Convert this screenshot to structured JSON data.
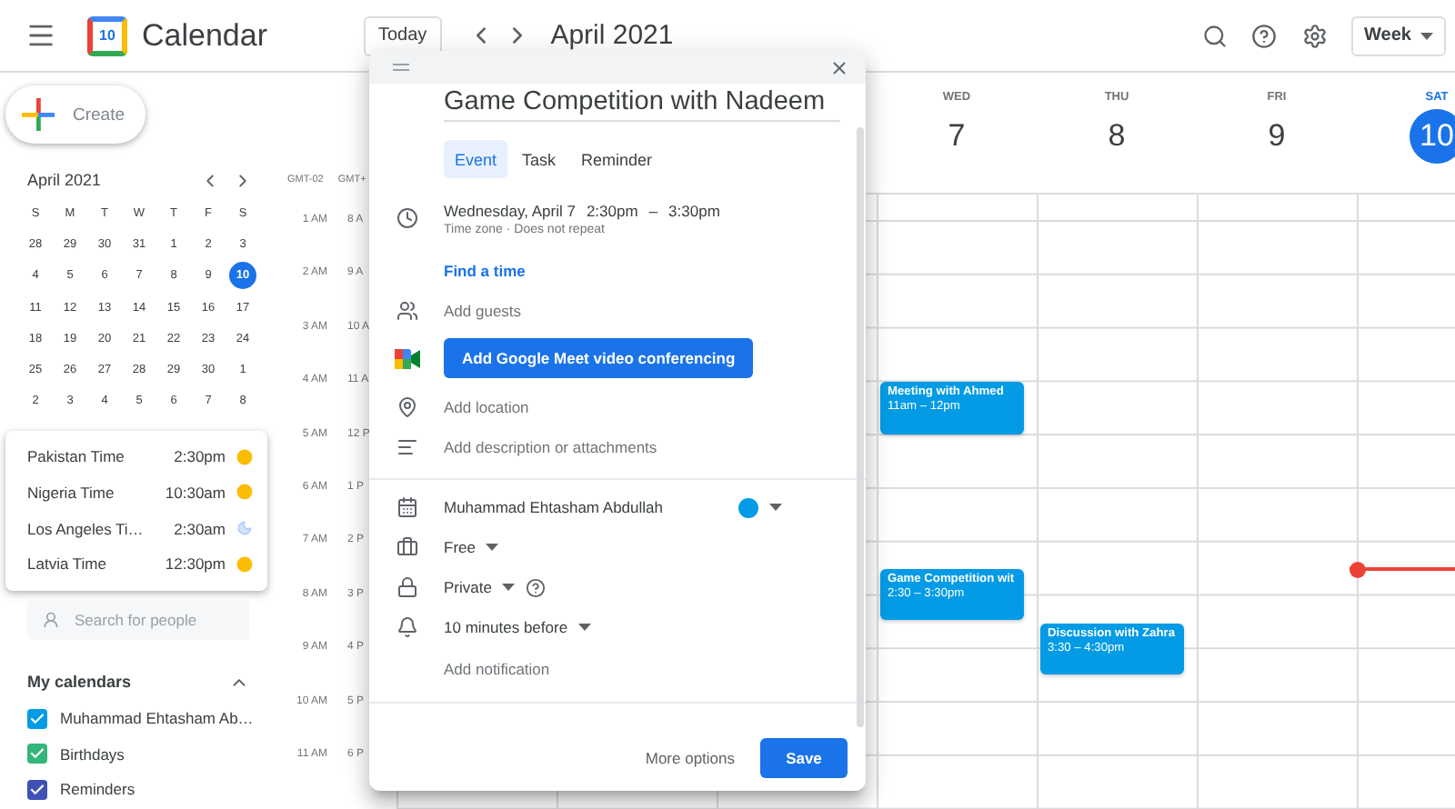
{
  "header": {
    "app_name": "Calendar",
    "logo_text": "10",
    "today": "Today",
    "period": "April 2021",
    "view": "Week"
  },
  "create": "Create",
  "mini_calendar": {
    "title": "April 2021",
    "weekdays": [
      "S",
      "M",
      "T",
      "W",
      "T",
      "F",
      "S"
    ],
    "weeks": [
      [
        {
          "day": "28",
          "selected": false
        },
        {
          "day": "29",
          "selected": false
        },
        {
          "day": "30",
          "selected": false
        },
        {
          "day": "31",
          "selected": false
        },
        {
          "day": "1",
          "selected": false
        },
        {
          "day": "2",
          "selected": false
        },
        {
          "day": "3",
          "selected": false
        }
      ],
      [
        {
          "day": "4",
          "selected": false
        },
        {
          "day": "5",
          "selected": false
        },
        {
          "day": "6",
          "selected": false
        },
        {
          "day": "7",
          "selected": false
        },
        {
          "day": "8",
          "selected": false
        },
        {
          "day": "9",
          "selected": false
        },
        {
          "day": "10",
          "selected": true
        }
      ],
      [
        {
          "day": "11",
          "selected": false
        },
        {
          "day": "12",
          "selected": false
        },
        {
          "day": "13",
          "selected": false
        },
        {
          "day": "14",
          "selected": false
        },
        {
          "day": "15",
          "selected": false
        },
        {
          "day": "16",
          "selected": false
        },
        {
          "day": "17",
          "selected": false
        }
      ],
      [
        {
          "day": "18",
          "selected": false
        },
        {
          "day": "19",
          "selected": false
        },
        {
          "day": "20",
          "selected": false
        },
        {
          "day": "21",
          "selected": false
        },
        {
          "day": "22",
          "selected": false
        },
        {
          "day": "23",
          "selected": false
        },
        {
          "day": "24",
          "selected": false
        }
      ],
      [
        {
          "day": "25",
          "selected": false
        },
        {
          "day": "26",
          "selected": false
        },
        {
          "day": "27",
          "selected": false
        },
        {
          "day": "28",
          "selected": false
        },
        {
          "day": "29",
          "selected": false
        },
        {
          "day": "30",
          "selected": false
        },
        {
          "day": "1",
          "selected": false
        }
      ],
      [
        {
          "day": "2",
          "selected": false
        },
        {
          "day": "3",
          "selected": false
        },
        {
          "day": "4",
          "selected": false
        },
        {
          "day": "5",
          "selected": false
        },
        {
          "day": "6",
          "selected": false
        },
        {
          "day": "7",
          "selected": false
        },
        {
          "day": "8",
          "selected": false
        }
      ]
    ]
  },
  "world_clock": [
    {
      "place": "Pakistan Time",
      "time": "2:30pm",
      "kind": "day"
    },
    {
      "place": "Nigeria Time",
      "time": "10:30am",
      "kind": "day"
    },
    {
      "place": "Los Angeles Ti…",
      "time": "2:30am",
      "kind": "night"
    },
    {
      "place": "Latvia Time",
      "time": "12:30pm",
      "kind": "day"
    }
  ],
  "people_search": {
    "placeholder": "Search for people"
  },
  "my_calendars": {
    "title": "My calendars",
    "expanded": true,
    "items": [
      {
        "name": "Muhammad Ehtasham Ab…",
        "checked": true,
        "color": "#039be5"
      },
      {
        "name": "Birthdays",
        "checked": true,
        "color": "#33b679"
      },
      {
        "name": "Reminders",
        "checked": true,
        "color": "#3f51b5"
      }
    ]
  },
  "timezones": [
    "GMT-02",
    "GMT+"
  ],
  "hours": [
    {
      "primary": "1 AM",
      "secondary": "8 A"
    },
    {
      "primary": "2 AM",
      "secondary": "9 A"
    },
    {
      "primary": "3 AM",
      "secondary": "10 A"
    },
    {
      "primary": "4 AM",
      "secondary": "11 A"
    },
    {
      "primary": "5 AM",
      "secondary": "12 P"
    },
    {
      "primary": "6 AM",
      "secondary": "1 P"
    },
    {
      "primary": "7 AM",
      "secondary": "2 P"
    },
    {
      "primary": "8 AM",
      "secondary": "3 P"
    },
    {
      "primary": "9 AM",
      "secondary": "4 P"
    },
    {
      "primary": "10 AM",
      "secondary": "5 P"
    },
    {
      "primary": "11 AM",
      "secondary": "6 P"
    }
  ],
  "days": [
    {
      "weekday": "WED",
      "date": "7",
      "today": false,
      "events": [
        {
          "title": "Meeting with Ahmed",
          "time": "11am – 12pm",
          "color": "#039be5"
        },
        {
          "title": "Game Competition wit",
          "time": "2:30 – 3:30pm",
          "color": "#039be5"
        }
      ]
    },
    {
      "weekday": "THU",
      "date": "8",
      "today": false,
      "events": [
        {
          "title": "Discussion with Zahra",
          "time": "3:30 – 4:30pm",
          "color": "#039be5"
        }
      ]
    },
    {
      "weekday": "FRI",
      "date": "9",
      "today": false
    },
    {
      "weekday": "SAT",
      "date": "10",
      "today": true
    }
  ],
  "dialog": {
    "title": "Game Competition with Nadeem",
    "tabs": [
      {
        "label": "Event",
        "selected": true
      },
      {
        "label": "Task",
        "selected": false
      },
      {
        "label": "Reminder",
        "selected": false
      }
    ],
    "date": "Wednesday, April 7",
    "start": "2:30pm",
    "dash": "–",
    "end": "3:30pm",
    "recurrence": "Time zone · Does not repeat",
    "find_time": "Find a time",
    "guests": "Add guests",
    "meet": "Add Google Meet video conferencing",
    "location": "Add location",
    "description": "Add description or attachments",
    "calendar": {
      "name": "Muhammad Ehtasham Abdullah",
      "color": "#039be5"
    },
    "availability": "Free",
    "visibility": "Private",
    "reminder": "10 minutes before",
    "add_notification": "Add notification",
    "more_options": "More options",
    "save": "Save"
  }
}
